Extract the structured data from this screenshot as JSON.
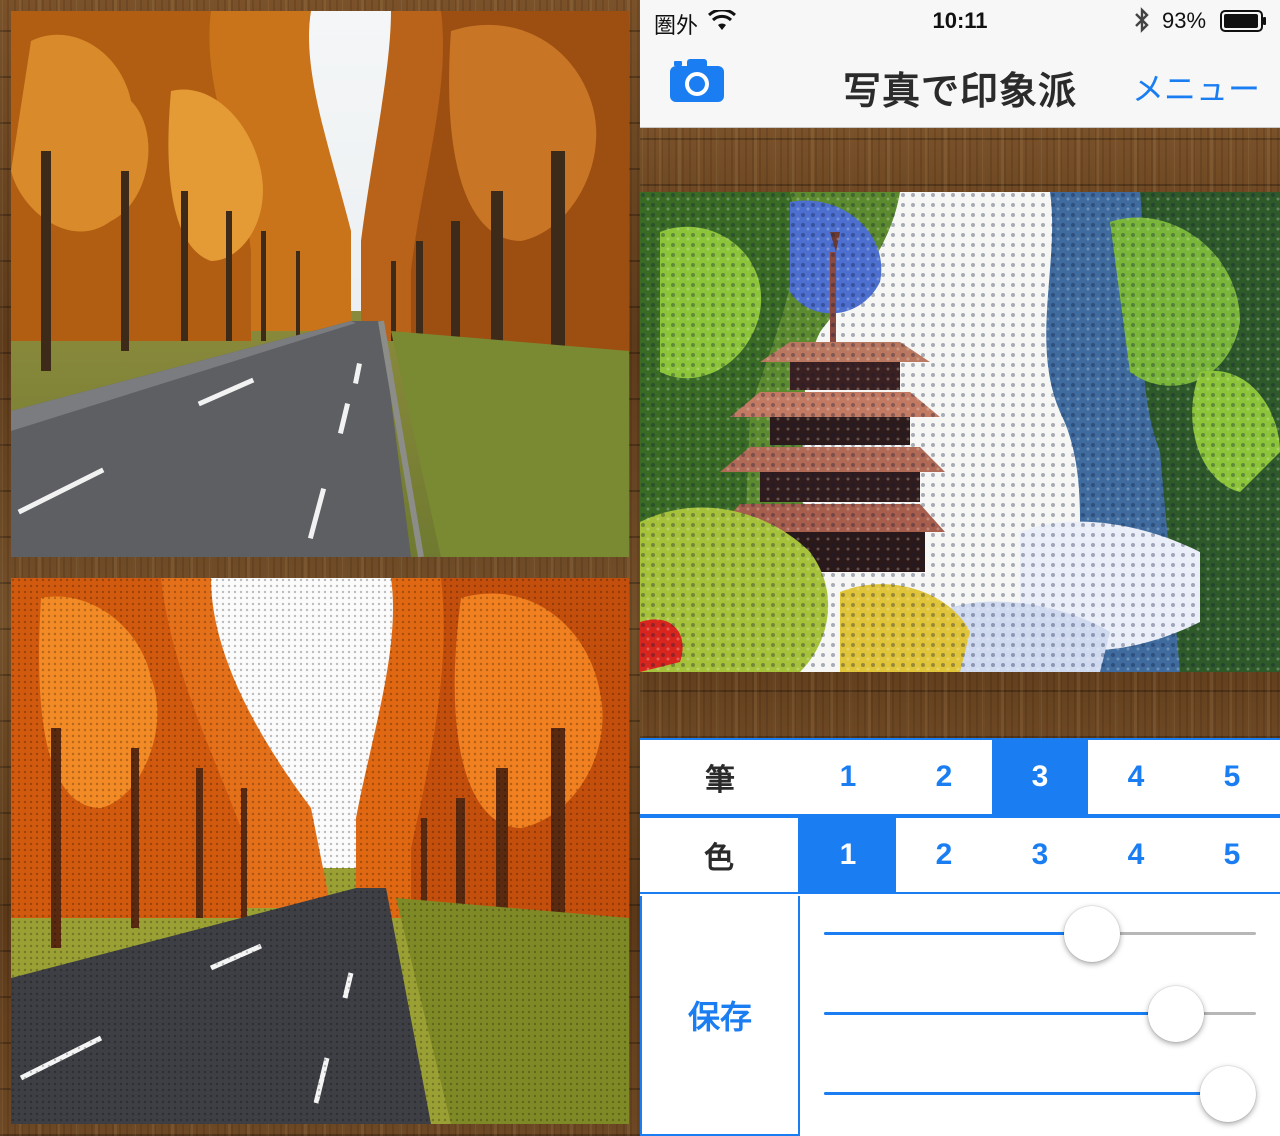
{
  "status_bar": {
    "carrier": "圏外",
    "time": "10:11",
    "battery_percent": "93%",
    "wifi_icon": "wifi-icon",
    "bluetooth_icon": "bluetooth-icon",
    "battery_icon": "battery-icon"
  },
  "nav": {
    "title": "写真で印象派",
    "menu_label": "メニュー",
    "camera_icon": "camera-icon"
  },
  "brush": {
    "label": "筆",
    "options": [
      "1",
      "2",
      "3",
      "4",
      "5"
    ],
    "selected": "3"
  },
  "color": {
    "label": "色",
    "options": [
      "1",
      "2",
      "3",
      "4",
      "5"
    ],
    "selected": "1"
  },
  "save_label": "保存",
  "sliders": [
    {
      "value": 0.62
    },
    {
      "value": 0.815
    },
    {
      "value": 1.0
    }
  ],
  "colors": {
    "accent": "#1a7ef2",
    "nav_background": "#f7f7f7",
    "wood": "#6b4522"
  }
}
